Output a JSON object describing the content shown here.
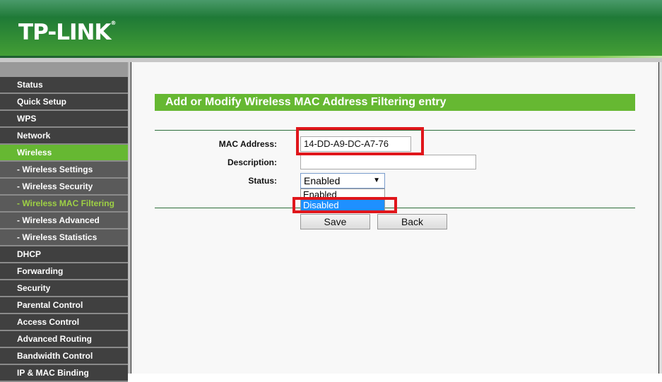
{
  "brand": {
    "logo": "TP-LINK",
    "registered": "®"
  },
  "sidebar": {
    "items": [
      {
        "label": "Status"
      },
      {
        "label": "Quick Setup"
      },
      {
        "label": "WPS"
      },
      {
        "label": "Network"
      },
      {
        "label": "Wireless",
        "active": true
      },
      {
        "label": "- Wireless Settings"
      },
      {
        "label": "- Wireless Security"
      },
      {
        "label": "- Wireless MAC Filtering",
        "current": true
      },
      {
        "label": "- Wireless Advanced"
      },
      {
        "label": "- Wireless Statistics"
      },
      {
        "label": "DHCP"
      },
      {
        "label": "Forwarding"
      },
      {
        "label": "Security"
      },
      {
        "label": "Parental Control"
      },
      {
        "label": "Access Control"
      },
      {
        "label": "Advanced Routing"
      },
      {
        "label": "Bandwidth Control"
      },
      {
        "label": "IP & MAC Binding"
      }
    ]
  },
  "form": {
    "title": "Add or Modify Wireless MAC Address Filtering entry",
    "mac_label": "MAC Address:",
    "mac_value": "14-DD-A9-DC-A7-76",
    "desc_label": "Description:",
    "desc_value": "",
    "status_label": "Status:",
    "status_value": "Enabled",
    "status_options": [
      "Enabled",
      "Disabled"
    ],
    "highlighted_option": "Disabled",
    "save": "Save",
    "back": "Back"
  },
  "colors": {
    "accent": "#66b832",
    "highlight": "#e0161b",
    "selection": "#1e90ff"
  }
}
